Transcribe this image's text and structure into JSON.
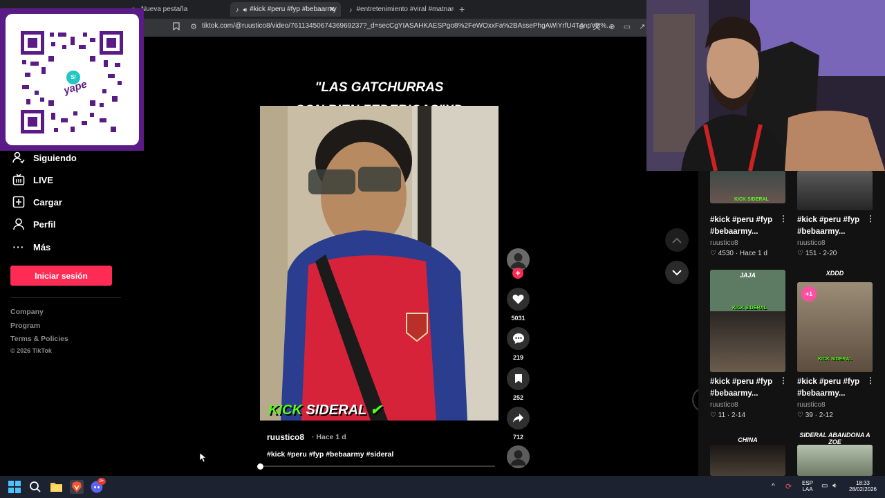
{
  "browser": {
    "tabs": [
      {
        "label": "Nueva pestaña",
        "active": false
      },
      {
        "label": "#kick #peru #fyp #bebaarmy",
        "active": true
      },
      {
        "label": "#entretenimiento #viral #matnarok |",
        "active": false
      }
    ],
    "url": "tiktok.com/@ruustico8/video/7611345067436969237?_d=secCgYIASAHKAESPgo8%2FeWOxxFa%2BAssePhgAWiYrfU4T4npVB%..."
  },
  "overlay": {
    "brand": "yape",
    "currency_badge": "S/"
  },
  "sidebar": {
    "items": [
      {
        "label": "Siguiendo",
        "icon": "following-icon"
      },
      {
        "label": "LIVE",
        "icon": "live-icon"
      },
      {
        "label": "Cargar",
        "icon": "upload-icon"
      },
      {
        "label": "Perfil",
        "icon": "profile-icon"
      },
      {
        "label": "Más",
        "icon": "more-icon"
      }
    ],
    "login_label": "Iniciar sesión",
    "footer": {
      "company": "Company",
      "program": "Program",
      "terms": "Terms & Policies",
      "copyright": "© 2026 TikTok"
    }
  },
  "video": {
    "caption_line1": "\"LAS GATCHURRAS",
    "caption_line2": "SON BIEN FEDERICAS\"XD",
    "watermark_kick": "KICK",
    "watermark_sideral": "SIDERAL",
    "author": "ruustico8",
    "time": "· Hace 1 d",
    "description": "#kick #peru #fyp #bebaarmy #sideral",
    "likes": "5031",
    "comments": "219",
    "saves": "252",
    "shares": "712",
    "progress": 0.0
  },
  "related": [
    {
      "title": "#kick #peru #fyp #bebaarmy...",
      "author": "ruustico8",
      "likes": "4530",
      "date": "Hace 1 d"
    },
    {
      "title": "#kick #peru #fyp #bebaarmy...",
      "author": "ruustico8",
      "likes": "151",
      "date": "2-20"
    },
    {
      "title": "#kick #peru #fyp #bebaarmy...",
      "author": "ruustico8",
      "likes": "11",
      "date": "2-14",
      "label": "JAJA"
    },
    {
      "title": "#kick #peru #fyp #bebaarmy...",
      "author": "ruustico8",
      "likes": "39",
      "date": "2-12",
      "label": "XDDD"
    },
    {
      "label": "CHINA"
    },
    {
      "label": "SIDERAL ABANDONA A ZOE"
    }
  ],
  "taskbar": {
    "lang": "ESP",
    "layout": "LAA",
    "time": "18:33",
    "date": "28/02/2026",
    "discord_badge": "9+"
  },
  "colors": {
    "accent": "#fe2c55",
    "kick_green": "#53fc18",
    "yape_purple": "#5a1b86"
  }
}
